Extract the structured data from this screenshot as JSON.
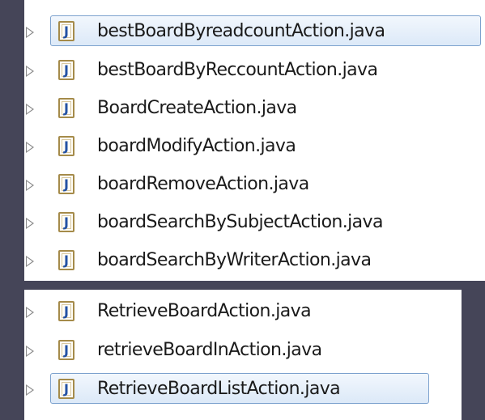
{
  "top_list": {
    "items": [
      {
        "label": "bestBoardByreadcountAction.java",
        "selected": true
      },
      {
        "label": "bestBoardByReccountAction.java",
        "selected": false
      },
      {
        "label": "BoardCreateAction.java",
        "selected": false
      },
      {
        "label": "boardModifyAction.java",
        "selected": false
      },
      {
        "label": "boardRemoveAction.java",
        "selected": false
      },
      {
        "label": "boardSearchBySubjectAction.java",
        "selected": false
      },
      {
        "label": "boardSearchByWriterAction.java",
        "selected": false
      }
    ]
  },
  "bottom_list": {
    "items": [
      {
        "label": "RetrieveBoardAction.java",
        "selected": false
      },
      {
        "label": "retrieveBoardInAction.java",
        "selected": false
      },
      {
        "label": "RetrieveBoardListAction.java",
        "selected": true
      }
    ]
  },
  "icons": {
    "file": "java-file-icon",
    "expand": "expand-arrow-icon"
  },
  "colors": {
    "background": "#454558",
    "selection_border": "#7da2ce",
    "icon_letter": "#2452a4"
  }
}
